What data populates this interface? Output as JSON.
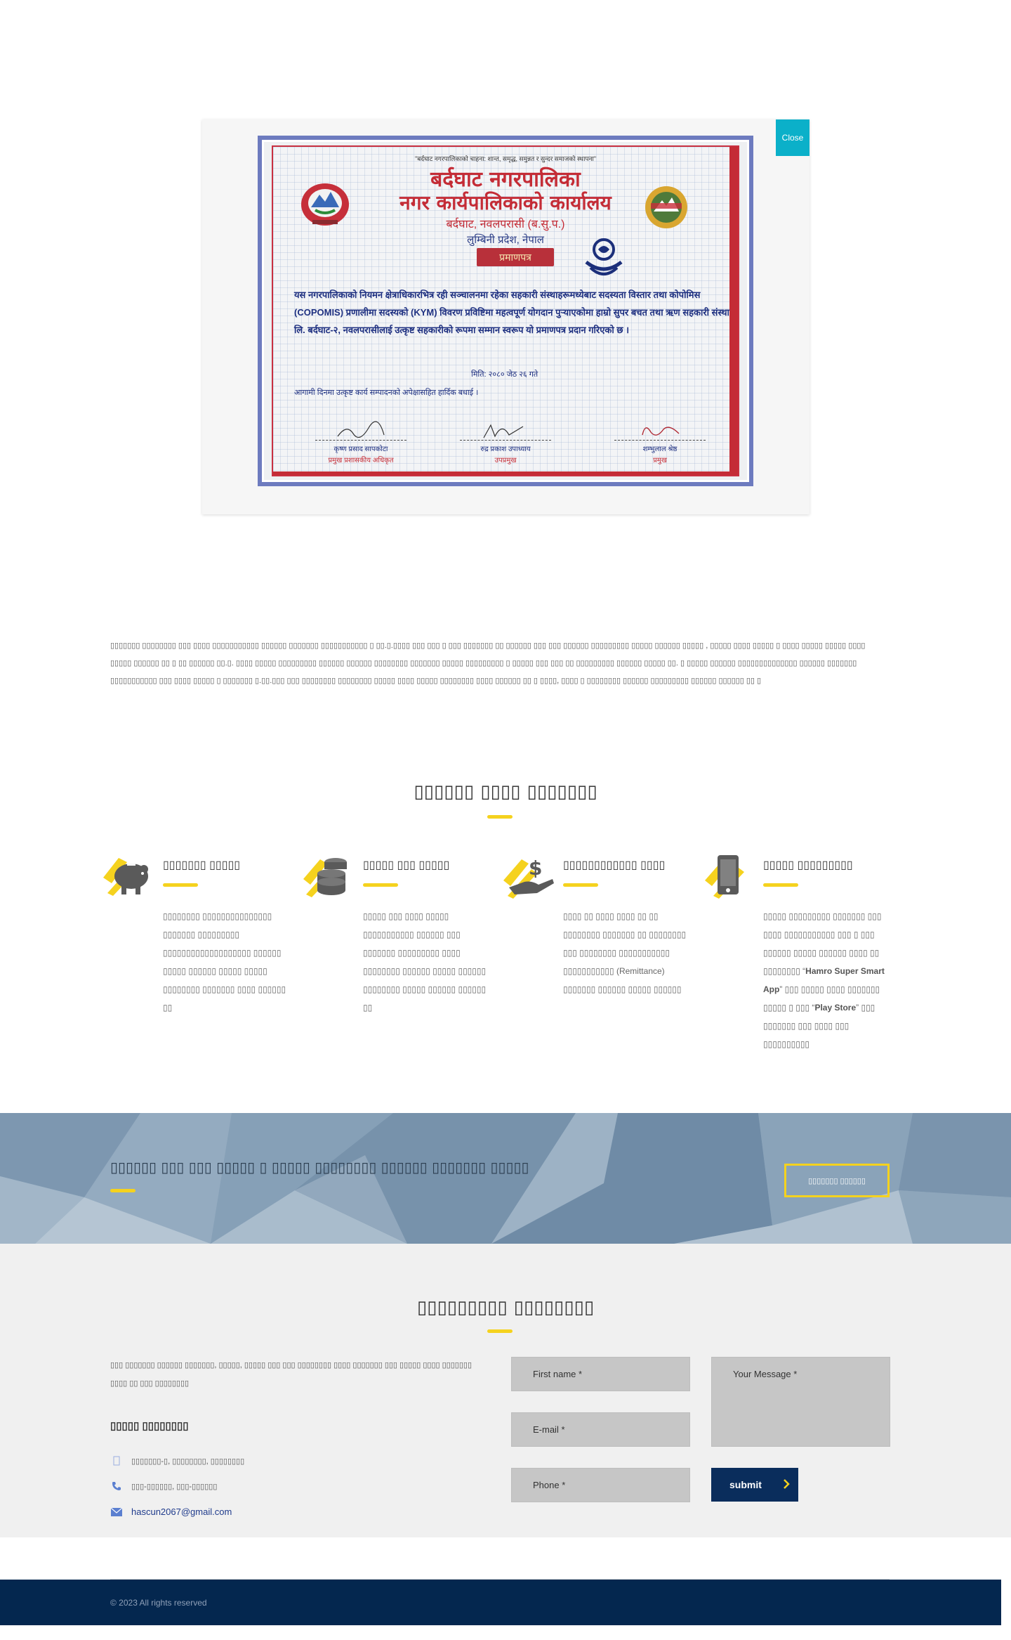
{
  "modal": {
    "close_label": "Close",
    "certificate": {
      "motto": "\"बर्दघाट नगरपालिकाको चाहना: शान्त, समृद्ध, समुन्नत र सुन्दर समाजको स्थापना\"",
      "title_line1": "बर्दघाट नगरपालिका",
      "title_line2": "नगर कार्यपालिकाको कार्यालय",
      "location": "बर्दघाट, नवलपरासी (ब.सु.प.)",
      "province": "लुम्बिनी प्रदेश, नेपाल",
      "ribbon": "प्रमाणपत्र",
      "body": "यस नगरपालिकाको नियमन क्षेत्राधिकारभित्र रही सञ्चालनमा रहेका सहकारी संस्थाहरूमध्येबाट सदस्यता विस्तार तथा कोपोमिस (COPOMIS) प्रणालीमा सदस्यको (KYM) विवरण प्रविष्टिमा महत्वपूर्ण योगदान पुऱ्याएकोमा हाम्रो सुपर बचत तथा ऋण सहकारी संस्था लि. बर्दघाट-२, नवलपरासीलाई उत्कृष्ट सहकारीको रूपमा सम्मान स्वरूप यो प्रमाणपत्र प्रदान गरिएको छ ।",
      "date": "मिति: २०८० जेठ २६ गते",
      "wish": "आगामी दिनमा उत्कृष्ट कार्य सम्पादनको अपेक्षासहित हार्दिक बधाई ।",
      "signatories": [
        {
          "name": "कृष्ण प्रसाद सापकोटा",
          "role": "प्रमुख प्रशासकीय अधिकृत"
        },
        {
          "name": "रुद्र प्रकाश उपाध्याय",
          "role": "उपप्रमुख"
        },
        {
          "name": "शम्भुलाल श्रेष्ठ",
          "role": "प्रमुख"
        }
      ]
    }
  },
  "intro": {
    "text": "▯▯▯▯▯▯▯ ▯▯▯▯▯▯▯▯ ▯▯▯ ▯▯▯▯ ▯▯▯▯▯▯▯▯▯▯▯ ▯▯▯▯▯▯  ▯▯▯▯▯▯▯ ▯▯▯▯▯▯▯▯▯▯▯  ▯ ▯▯.▯.▯▯▯▯ ▯▯▯ ▯▯▯ ▯ ▯▯▯ ▯▯▯▯▯▯▯ ▯▯ ▯▯▯▯▯▯ ▯▯▯ ▯▯▯ ▯▯▯▯▯▯ ▯▯▯▯▯▯▯▯▯ ▯▯▯▯▯ ▯▯▯▯▯▯ ▯▯▯▯▯ , ▯▯▯▯▯ ▯▯▯▯ ▯▯▯▯▯ ▯ ▯▯▯▯ ▯▯▯▯▯ ▯▯▯▯▯ ▯▯▯▯ ▯▯▯▯▯ ▯▯▯▯▯▯ ▯▯ ▯ ▯▯ ▯▯▯▯▯▯ ▯▯.▯. ▯▯▯▯ ▯▯▯▯▯ ▯▯▯▯▯▯▯▯▯ ▯▯▯▯▯▯ ▯▯▯▯▯▯ ▯▯▯▯▯▯▯▯ ▯▯▯▯▯▯▯ ▯▯▯▯▯ ▯▯▯▯▯▯▯▯▯ ▯ ▯▯▯▯▯ ▯▯▯ ▯▯▯ ▯▯ ▯▯▯▯▯▯▯▯▯ ▯▯▯▯▯▯ ▯▯▯▯▯ ▯▯. ▯ ▯▯▯▯▯ ▯▯▯▯▯▯ ▯▯▯▯▯▯▯▯▯▯▯▯▯▯ ▯▯▯▯▯▯ ▯▯▯▯▯▯▯ ▯▯▯▯▯▯▯▯▯▯▯ ▯▯▯ ▯▯▯▯ ▯▯▯▯▯  ▯ ▯▯▯▯▯▯▯ ▯.▯▯.▯▯▯ ▯▯▯ ▯▯▯▯▯▯▯▯ ▯▯▯▯▯▯▯▯ ▯▯▯▯▯ ▯▯▯▯ ▯▯▯▯▯ ▯▯▯▯▯▯▯▯ ▯▯▯▯ ▯▯▯▯▯▯ ▯▯ ▯ ▯▯▯▯, ▯▯▯▯ ▯ ▯▯▯▯▯▯▯▯ ▯▯▯▯▯▯ ▯▯▯▯▯▯▯▯▯ ▯▯▯▯▯▯ ▯▯▯▯▯▯ ▯▯ ▯"
  },
  "services": {
    "title": "▯▯▯▯▯▯ ▯▯▯▯ ▯▯▯▯▯▯▯",
    "items": [
      {
        "title": "▯▯▯▯▯▯▯ ▯▯▯▯▯",
        "text": "▯▯▯▯▯▯▯▯ ▯▯▯▯▯▯▯▯▯▯▯▯▯▯▯ ▯▯▯▯▯▯▯ ▯▯▯▯▯▯▯▯▯ ▯▯▯▯▯▯▯▯▯▯▯▯▯▯▯▯▯▯▯ ▯▯▯▯▯▯ ▯▯▯▯▯ ▯▯▯▯▯▯ ▯▯▯▯▯ ▯▯▯▯▯ ▯▯▯▯▯▯▯▯ ▯▯▯▯▯▯▯ ▯▯▯▯ ▯▯▯▯▯▯ ▯▯",
        "icon": "piggy-bank-icon"
      },
      {
        "title": "▯▯▯▯▯ ▯▯▯ ▯▯▯▯▯",
        "text": "▯▯▯▯▯ ▯▯▯ ▯▯▯▯ ▯▯▯▯▯ ▯▯▯▯▯▯▯▯▯▯▯ ▯▯▯▯▯▯ ▯▯▯ ▯▯▯▯▯▯▯ ▯▯▯▯▯▯▯▯▯ ▯▯▯▯ ▯▯▯▯▯▯▯▯ ▯▯▯▯▯▯ ▯▯▯▯▯ ▯▯▯▯▯▯ ▯▯▯▯▯▯▯▯ ▯▯▯▯▯ ▯▯▯▯▯▯ ▯▯▯▯▯▯ ▯▯",
        "icon": "coins-icon"
      },
      {
        "title": "▯▯▯▯▯▯▯▯▯▯▯▯ ▯▯▯▯",
        "text": "▯▯▯▯ ▯▯ ▯▯▯▯ ▯▯▯▯ ▯▯ ▯▯ ▯▯▯▯▯▯▯▯ ▯▯▯▯▯▯▯ ▯▯ ▯▯▯▯▯▯▯▯ ▯▯▯ ▯▯▯▯▯▯▯▯ ▯▯▯▯▯▯▯▯▯▯▯ ▯▯▯▯▯▯▯▯▯▯▯ (Remittance) ▯▯▯▯▯▯▯ ▯▯▯▯▯▯ ▯▯▯▯▯ ▯▯▯▯▯▯",
        "icon": "money-hand-icon"
      },
      {
        "title": "▯▯▯▯▯ ▯▯▯▯▯▯▯▯▯",
        "text_before": "▯▯▯▯▯ ▯▯▯▯▯▯▯▯▯ ▯▯▯▯▯▯▯ ▯▯▯ ▯▯▯▯ ▯▯▯▯▯▯▯▯▯▯▯ ▯▯▯ ▯ ▯▯▯ ▯▯▯▯▯▯ ▯▯▯▯▯ ▯▯▯▯▯▯ ▯▯▯▯ ▯▯ ▯▯▯▯▯▯▯▯ “",
        "bold1": "Hamro Super Smart App",
        "text_mid": "” ▯▯▯ ▯▯▯▯▯ ▯▯▯▯ ▯▯▯▯▯▯▯ ▯▯▯▯▯ ▯ ▯▯▯ “",
        "bold2": "Play Store",
        "text_after": "” ▯▯▯ ▯▯▯▯▯▯▯ ▯▯▯ ▯▯▯▯ ▯▯▯ ▯▯▯▯▯▯▯▯▯▯",
        "icon": "mobile-phone-icon"
      }
    ]
  },
  "banner": {
    "text": "▯▯▯▯▯▯ ▯▯▯ ▯▯▯ ▯▯▯▯▯ ▯ ▯▯▯▯▯ ▯▯▯▯▯▯▯▯ ▯▯▯▯▯▯ ▯▯▯▯▯▯▯ ▯▯▯▯▯",
    "button": "▯▯▯▯▯▯▯ ▯▯▯▯▯▯"
  },
  "contact": {
    "title": "▯▯▯▯▯▯▯▯▯ ▯▯▯▯▯▯▯▯",
    "description": "▯▯▯ ▯▯▯▯▯▯▯ ▯▯▯▯▯▯ ▯▯▯▯▯▯▯, ▯▯▯▯▯, ▯▯▯▯▯ ▯▯▯ ▯▯▯ ▯▯▯▯▯▯▯▯ ▯▯▯▯ ▯▯▯▯▯▯▯ ▯▯▯ ▯▯▯▯▯ ▯▯▯▯ ▯▯▯▯▯▯▯ ▯▯▯▯ ▯▯ ▯▯▯ ▯▯▯▯▯▯▯▯",
    "address_title": "▯▯▯▯▯ ▯▯▯▯▯▯▯▯",
    "address": "▯▯▯▯▯▯▯-▯, ▯▯▯▯▯▯▯▯, ▯▯▯▯▯▯▯▯",
    "phone": "▯▯▯-▯▯▯▯▯▯, ▯▯▯-▯▯▯▯▯▯",
    "email": "hascun2067@gmail.com",
    "form": {
      "first_name": "First name *",
      "email": "E-mail *",
      "phone": "Phone *",
      "message": "Your Message *",
      "submit": "submit"
    }
  },
  "footer": {
    "copyright": "© 2023 All rights reserved"
  },
  "colors": {
    "accent_yellow": "#f5d21e",
    "close_button": "#0bb0c9",
    "navy": "#0a2d5c",
    "footer": "#04274f"
  }
}
